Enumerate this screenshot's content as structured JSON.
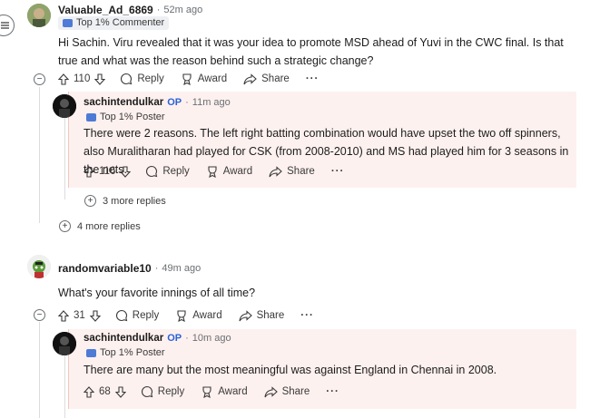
{
  "comments": [
    {
      "username": "Valuable_Ad_6869",
      "time": "52m ago",
      "flair": "Top 1% Commenter",
      "text": "Hi Sachin. Viru revealed that it was your idea to promote MSD ahead of Yuvi in the CWC final. Is that true and what was the reason behind such a strategic change?",
      "votes": "110",
      "reply_label": "Reply",
      "award_label": "Award",
      "share_label": "Share",
      "more_label": "···",
      "reply": {
        "username": "sachintendulkar",
        "op": "OP",
        "time": "11m ago",
        "flair": "Top 1% Poster",
        "text": "There were 2 reasons. The left right batting combination would have upset the two off spinners, also Muralitharan had played for CSK (from 2008-2010) and MS had played him for 3 seasons in the nets.",
        "votes": "116",
        "reply_label": "Reply",
        "award_label": "Award",
        "share_label": "Share",
        "more_label": "···"
      },
      "more_replies_nested": "3 more replies",
      "more_replies": "4 more replies"
    },
    {
      "username": "randomvariable10",
      "time": "49m ago",
      "text": "What's your favorite innings of all time?",
      "votes": "31",
      "reply_label": "Reply",
      "award_label": "Award",
      "share_label": "Share",
      "more_label": "···",
      "reply": {
        "username": "sachintendulkar",
        "op": "OP",
        "time": "10m ago",
        "flair": "Top 1% Poster",
        "text": "There are many but the most meaningful was against England in Chennai in 2008.",
        "votes": "68",
        "reply_label": "Reply",
        "award_label": "Award",
        "share_label": "Share",
        "more_label": "···"
      }
    }
  ],
  "sep": "·",
  "collapse_symbol": "−",
  "expand_symbol": "+"
}
